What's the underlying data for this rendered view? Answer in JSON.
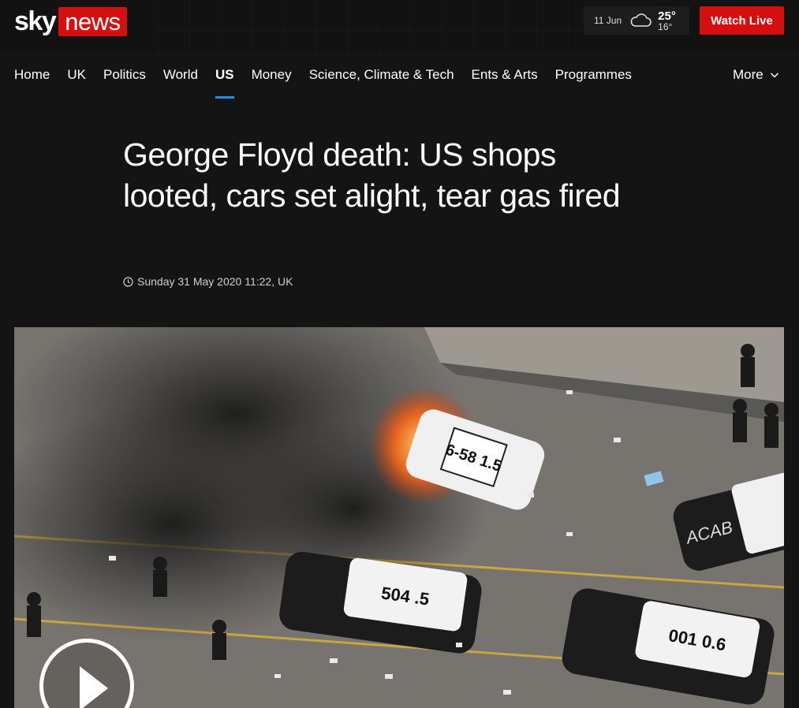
{
  "header": {
    "logo_sky": "sky",
    "logo_news": "news",
    "weather": {
      "date": "11 Jun",
      "high": "25°",
      "low": "16°",
      "icon": "cloud-icon"
    },
    "watch_live_label": "Watch Live"
  },
  "nav": {
    "items": [
      {
        "label": "Home"
      },
      {
        "label": "UK"
      },
      {
        "label": "Politics"
      },
      {
        "label": "World"
      },
      {
        "label": "US",
        "active": true
      },
      {
        "label": "Money"
      },
      {
        "label": "Science, Climate & Tech"
      },
      {
        "label": "Ents & Arts"
      },
      {
        "label": "Programmes"
      }
    ],
    "more_label": "More"
  },
  "article": {
    "headline": "George Floyd death: US shops looted, cars set alight, tear gas fired",
    "timestamp": "Sunday 31 May 2020 11:22, UK"
  },
  "hero": {
    "image_text": [
      "6-58",
      "1.5",
      "504",
      ".5",
      "ACAB",
      "001",
      "0.6"
    ],
    "play_icon": "play-icon"
  },
  "colors": {
    "accent_red": "#d50f0f",
    "active_tab_underline": "#2e8bd6",
    "background": "#141414"
  }
}
